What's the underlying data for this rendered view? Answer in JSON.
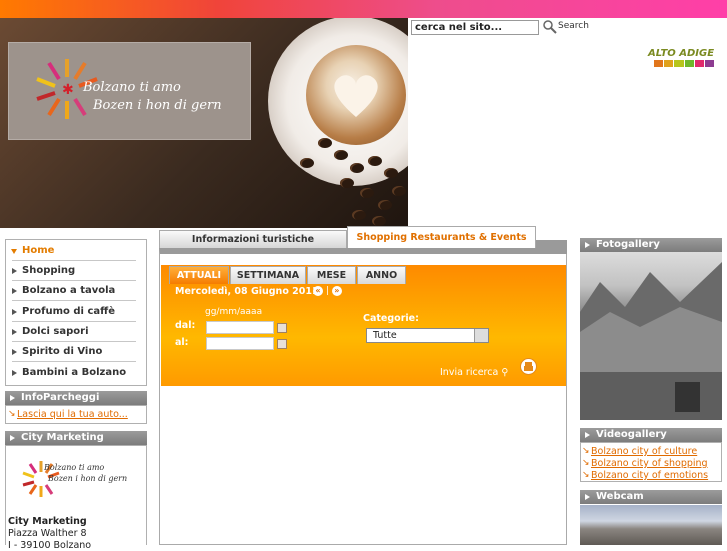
{
  "header": {
    "logo_text_1": "Bolzano ti amo",
    "logo_text_2": "Bozen i hon di gern",
    "search_value": "cerca nel sito...",
    "search_label": "Search",
    "region_logo": "ALTO ADIGE",
    "region_logo_colors": [
      "#e1761c",
      "#e0a11c",
      "#b7c51b",
      "#6fb72b",
      "#e12a6d",
      "#8d3c91"
    ]
  },
  "left_menu": {
    "items": [
      {
        "label": "Home",
        "active": true
      },
      {
        "label": "Shopping"
      },
      {
        "label": "Bolzano a tavola"
      },
      {
        "label": "Profumo di caffè"
      },
      {
        "label": "Dolci sapori"
      },
      {
        "label": "Spirito di Vino"
      },
      {
        "label": "Bambini a Bolzano"
      }
    ]
  },
  "info_parcheggi": {
    "title": "InfoParcheggi",
    "link": "Lascia qui la tua auto..."
  },
  "city_marketing": {
    "title": "City Marketing",
    "logo_text_1": "Bolzano ti amo",
    "logo_text_2": "Bozen i hon di gern",
    "address_name": "City Marketing",
    "address_street": "Piazza Walther 8",
    "address_city": "I - 39100 Bolzano"
  },
  "main_tabs": [
    {
      "label": "Informazioni turistiche",
      "active": false
    },
    {
      "label": "Shopping Restaurants & Events",
      "active": true
    }
  ],
  "event_tabs": [
    {
      "label": "ATTUALI",
      "active": true
    },
    {
      "label": "SETTIMANA"
    },
    {
      "label": "MESE"
    },
    {
      "label": "ANNO"
    }
  ],
  "events_form": {
    "date": "Mercoledì, 08 Giugno 2011",
    "nav_separator": "|",
    "date_format": "gg/mm/aaaa",
    "from_label": "dal:",
    "to_label": "al:",
    "category_label": "Categorie:",
    "category_value": "Tutte",
    "submit_label": "Invia ricerca"
  },
  "fotogallery": {
    "title": "Fotogallery"
  },
  "videogallery": {
    "title": "Videogallery",
    "links": [
      "Bolzano city of culture",
      "Bolzano city of shopping",
      "Bolzano city of emotions"
    ]
  },
  "webcam": {
    "title": "Webcam"
  }
}
